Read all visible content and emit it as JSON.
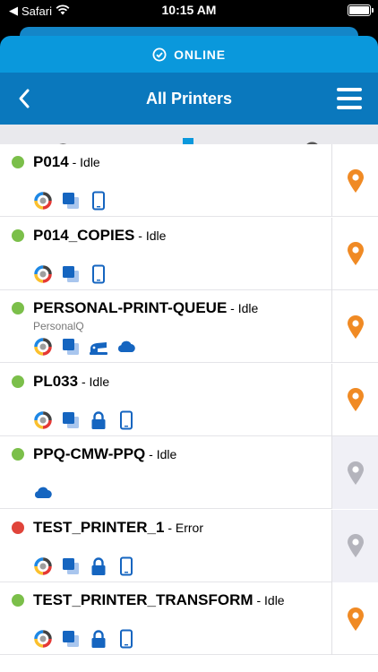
{
  "status_bar": {
    "carrier": "Safari",
    "time": "10:15 AM"
  },
  "connection": {
    "label": "ONLINE"
  },
  "nav": {
    "title": "All Printers"
  },
  "printers": [
    {
      "name": "P014",
      "status": " - Idle",
      "subtitle": "",
      "status_color": "#7bbf4a",
      "location_enabled": true,
      "icons": [
        "color-wheel-icon",
        "copy-icon",
        "mobile-icon"
      ]
    },
    {
      "name": "P014_COPIES",
      "status": " - Idle",
      "subtitle": "",
      "status_color": "#7bbf4a",
      "location_enabled": true,
      "icons": [
        "color-wheel-icon",
        "copy-icon",
        "mobile-icon"
      ]
    },
    {
      "name": "PERSONAL-PRINT-QUEUE",
      "status": " - Idle",
      "subtitle": "PersonalQ",
      "status_color": "#7bbf4a",
      "location_enabled": true,
      "icons": [
        "color-wheel-icon",
        "copy-icon",
        "stapler-icon",
        "cloud-icon"
      ]
    },
    {
      "name": "PL033",
      "status": " - Idle",
      "subtitle": "",
      "status_color": "#7bbf4a",
      "location_enabled": true,
      "icons": [
        "color-wheel-icon",
        "copy-icon",
        "lock-icon",
        "mobile-icon"
      ]
    },
    {
      "name": "PPQ-CMW-PPQ",
      "status": " - Idle",
      "subtitle": "",
      "status_color": "#7bbf4a",
      "location_enabled": false,
      "icons": [
        "cloud-icon"
      ]
    },
    {
      "name": "TEST_PRINTER_1",
      "status": " - Error",
      "subtitle": "",
      "status_color": "#e0443a",
      "location_enabled": false,
      "icons": [
        "color-wheel-icon",
        "copy-icon",
        "lock-icon",
        "mobile-icon"
      ]
    },
    {
      "name": "TEST_PRINTER_TRANSFORM",
      "status": " - Idle",
      "subtitle": "",
      "status_color": "#7bbf4a",
      "location_enabled": true,
      "icons": [
        "color-wheel-icon",
        "copy-icon",
        "lock-icon",
        "mobile-icon"
      ]
    }
  ],
  "colors": {
    "accent": "#0a98dc",
    "nav": "#0a78bd",
    "pin_active": "#f08a24",
    "pin_inactive": "#b4b4bc",
    "icon_blue": "#1565c0"
  }
}
